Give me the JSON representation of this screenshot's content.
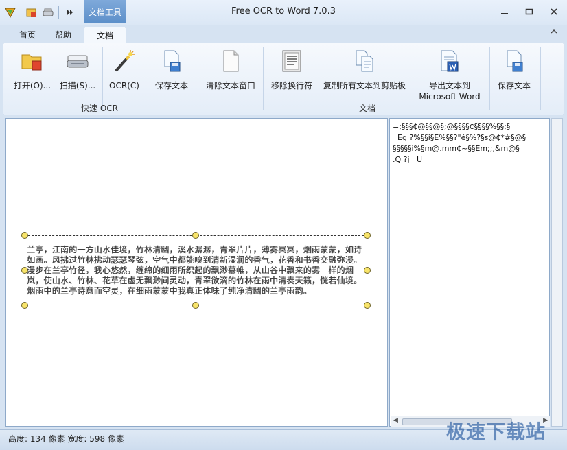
{
  "app": {
    "title": "Free OCR to Word 7.0.3",
    "context_tab_group": "文档工具"
  },
  "tabs": [
    {
      "label": "首页"
    },
    {
      "label": "帮助"
    },
    {
      "label": "文档",
      "active": true
    }
  ],
  "ribbon": {
    "groups": [
      {
        "label": "快速 OCR"
      },
      {
        "label": "文档"
      }
    ],
    "buttons": [
      {
        "label": "打开(O)...",
        "icon": "open-folder-icon"
      },
      {
        "label": "扫描(S)...",
        "icon": "scanner-icon"
      },
      {
        "label": "OCR(C)",
        "icon": "magic-wand-icon"
      },
      {
        "label": "保存文本",
        "icon": "save-document-icon"
      },
      {
        "label": "清除文本窗口",
        "icon": "blank-page-icon"
      },
      {
        "label": "移除换行符",
        "icon": "text-page-icon"
      },
      {
        "label": "复制所有文本到剪贴板",
        "icon": "copy-pages-icon"
      },
      {
        "label": "导出文本到\nMicrosoft Word",
        "icon": "word-export-icon"
      },
      {
        "label": "保存文本",
        "icon": "save-document-icon"
      }
    ]
  },
  "image_text": "兰亭，江南的一方山水佳境，竹林清幽，溪水潺潺，青翠片片，薄雾冥冥，烟雨蒙蒙，如诗如画。风拂过竹林拂动瑟瑟琴弦，空气中都能嗅到清新湿润的香气，花香和书香交融弥漫。漫步在兰亭竹径，我心悠然，缠绵的细雨所织起的飘渺幕帷，从山谷中飘来的雾一样的烟岚，使山水、竹林、花草在虚无飘渺间灵动，青翠欲滴的竹林在雨中清奏天籁，恍若仙境。烟雨中的兰亭诗意而空灵，在细雨蒙蒙中我真正体味了纯净清幽的兰亭雨韵。",
  "ocr_result": "=;§§§₵@§§@§;@§§§§₵§§§§%§§;§\n  Eg ?%§§i§E%§§?\"é§%?§s@₵*#§@§\n§§§§§i%§m@.mm₵~§§Em;;,&m@§\n.Q ?j   U",
  "status": {
    "text": "高度: 134 像素  宽度: 598 像素"
  },
  "watermark": "极速下载站",
  "colors": {
    "accent": "#5c8fc9",
    "ribbon_bg": "#e4edf8",
    "selection_handle": "#f8e46a"
  }
}
